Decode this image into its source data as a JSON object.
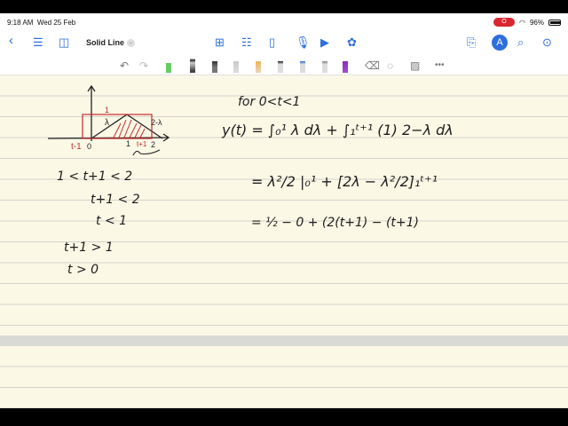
{
  "status": {
    "time": "9:18 AM",
    "date": "Wed 25 Feb",
    "battery": "96%",
    "recording": "O"
  },
  "nav": {
    "title": "Solid Line"
  },
  "toolbar": {
    "more": "•••"
  },
  "notes": {
    "diagram_labels": {
      "t_minus_1": "t-1",
      "zero": "0",
      "one": "1",
      "t_plus_1": "t+1",
      "two": "2",
      "lambda": "λ",
      "two_minus_lambda": "2-λ",
      "height": "1"
    },
    "left": [
      "1 < t+1 < 2",
      "t+1 < 2",
      "t < 1",
      "t+1 > 1",
      "t > 0"
    ],
    "right": {
      "condition": "for 0<t<1",
      "line1": "y(t) = ∫₀¹ λ dλ + ∫₁ᵗ⁺¹ (1) 2−λ dλ",
      "line2": "= λ²/2 |₀¹ + [2λ − λ²/2]₁ᵗ⁺¹",
      "line3": "= ½ − 0 + (2(t+1) − (t+1)"
    }
  }
}
